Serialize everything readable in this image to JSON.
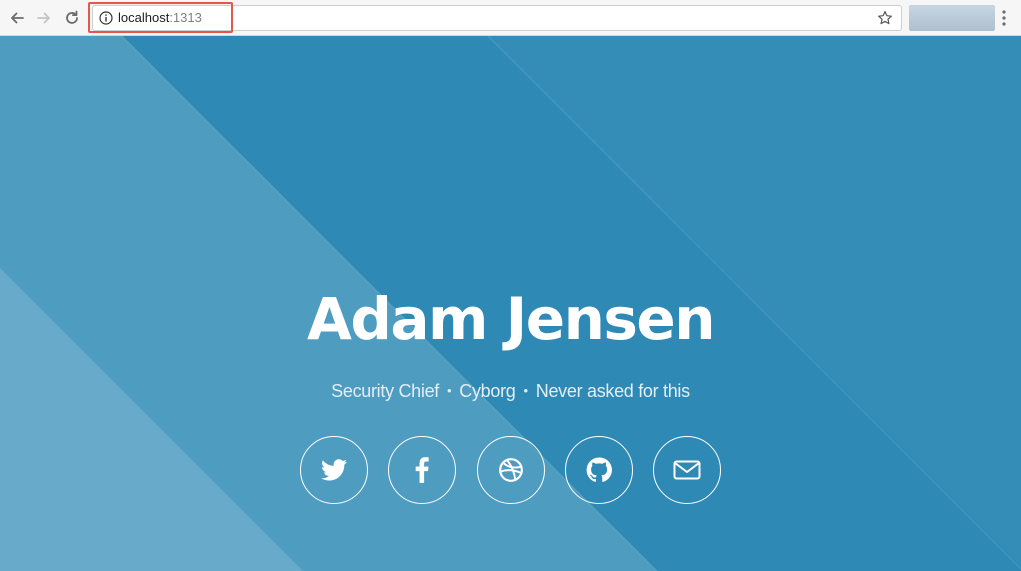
{
  "browser": {
    "url_host": "localhost",
    "url_port": ":1313"
  },
  "hero": {
    "title": "Adam Jensen",
    "subtitle_items": [
      "Security Chief",
      "Cyborg",
      "Never asked for this"
    ],
    "separator": "•",
    "background_color": "#2e8ab5",
    "social_links": [
      {
        "icon": "twitter-icon"
      },
      {
        "icon": "facebook-icon"
      },
      {
        "icon": "dribbble-icon"
      },
      {
        "icon": "github-icon"
      },
      {
        "icon": "email-icon"
      }
    ]
  }
}
